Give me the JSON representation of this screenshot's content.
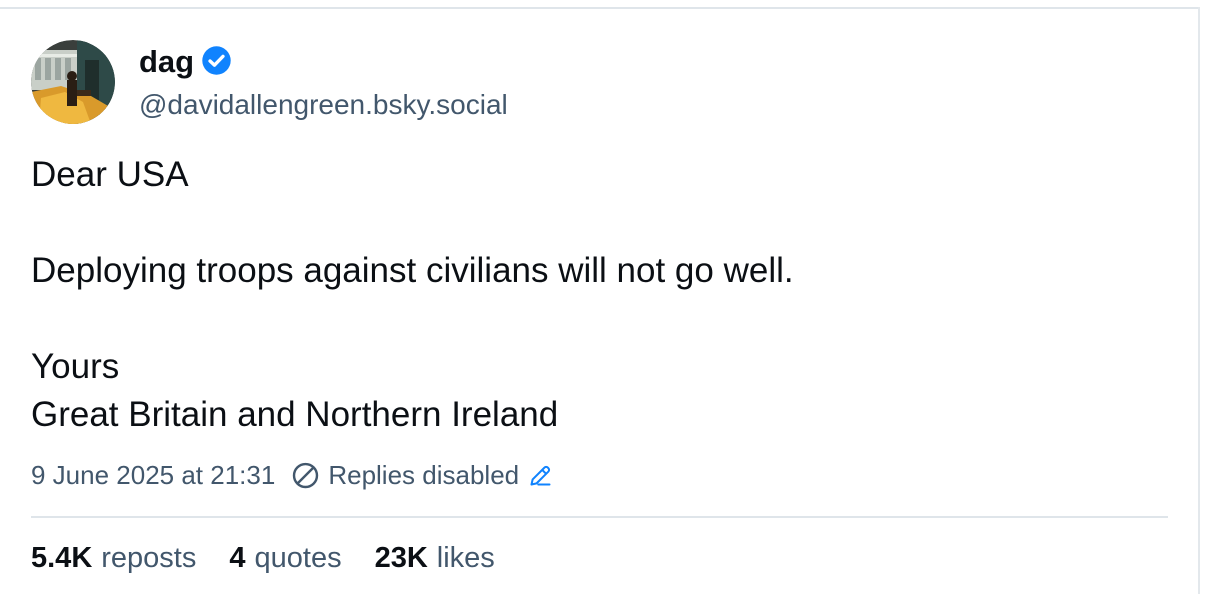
{
  "author": {
    "display_name": "dag",
    "handle": "@davidallengreen.bsky.social",
    "verified": true,
    "verified_color": "#1083fe"
  },
  "post": {
    "lines": [
      "Dear USA",
      "",
      "Deploying troops against civilians will not go well.",
      "",
      "Yours",
      "Great Britain and Northern Ireland"
    ]
  },
  "meta": {
    "timestamp": "9 June 2025 at 21:31",
    "replies_status": "Replies disabled",
    "replies_icon": "circle-slash-icon",
    "edit_icon": "pencil-icon",
    "edit_icon_color": "#1083fe"
  },
  "stats": {
    "reposts_count": "5.4K",
    "reposts_label": "reposts",
    "quotes_count": "4",
    "quotes_label": "quotes",
    "likes_count": "23K",
    "likes_label": "likes"
  },
  "colors": {
    "text_primary": "#0b0f14",
    "text_secondary": "#42576c",
    "divider": "#dfe5ea",
    "accent": "#1083fe"
  }
}
